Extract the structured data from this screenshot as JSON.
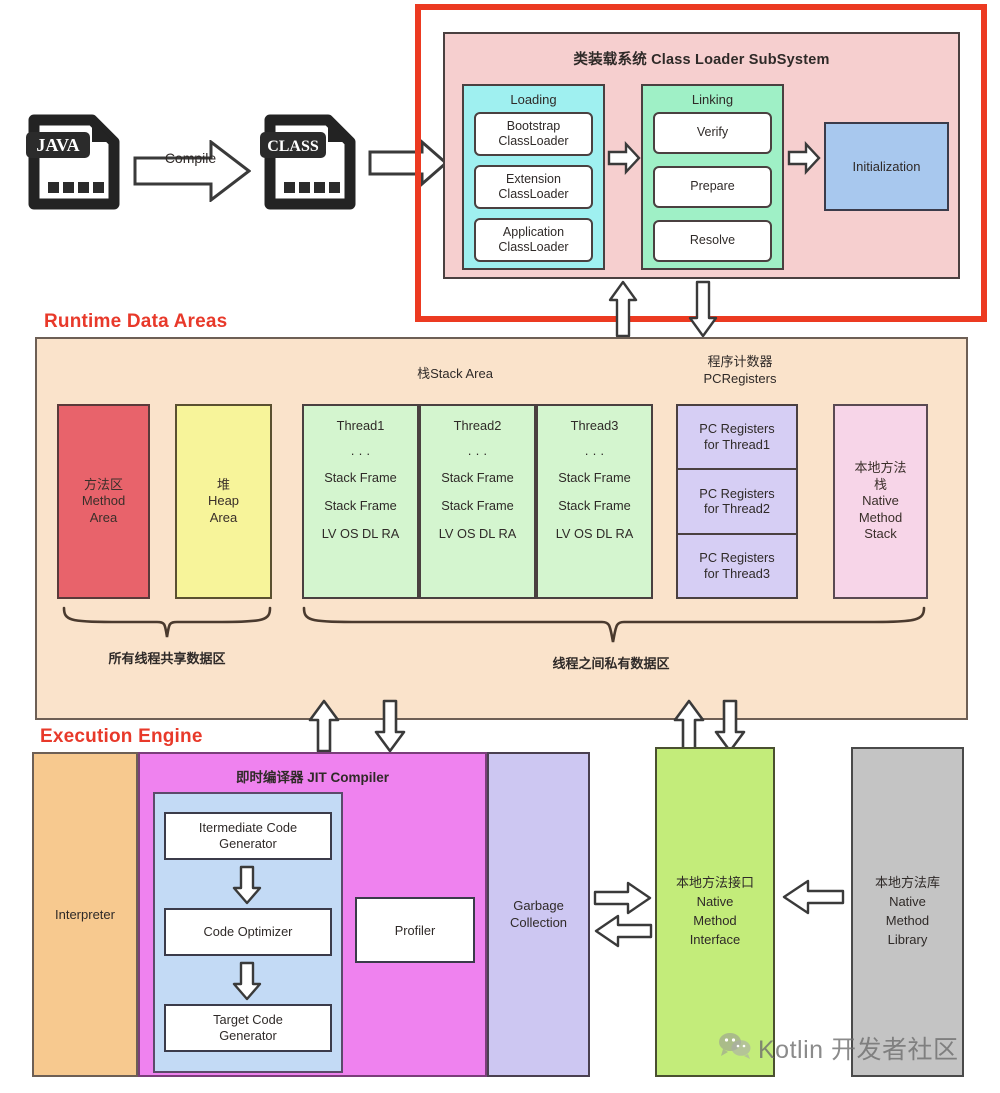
{
  "pipeline": {
    "java_file_label": "JAVA",
    "class_file_label": "CLASS",
    "compile_label": "Compile"
  },
  "class_loader": {
    "title": "类装载系统 Class Loader SubSystem",
    "loading": {
      "title": "Loading",
      "items": [
        "Bootstrap\nClassLoader",
        "Extension\nClassLoader",
        "Application\nClassLoader"
      ],
      "item_line1": [
        "Bootstrap",
        "Extension",
        "Application"
      ],
      "item_line2": [
        "ClassLoader",
        "ClassLoader",
        "ClassLoader"
      ]
    },
    "linking": {
      "title": "Linking",
      "items": [
        "Verify",
        "Prepare",
        "Resolve"
      ]
    },
    "initialization": "Initialization",
    "frame_color": "#ec3a21",
    "panel_color": "#f6cfcf",
    "loading_color": "#9ff0f0",
    "linking_color": "#9ff0c6",
    "initialization_color": "#a8c8ee"
  },
  "runtime_data_areas": {
    "section_title": "Runtime Data Areas",
    "panel_color": "#fae3cb",
    "stack_area_heading": "栈Stack Area",
    "pc_registers_heading_line1": "程序计数器",
    "pc_registers_heading_line2": "PCRegisters",
    "method_area": {
      "line1": "方法区",
      "line2": "Method",
      "line3": "Area",
      "color": "#e8636b"
    },
    "heap_area": {
      "line1": "堆",
      "line2": "Heap",
      "line3": "Area",
      "color": "#f7f49a"
    },
    "threads": [
      {
        "name": "Thread1",
        "dots": "· · ·",
        "frames": [
          "Stack Frame",
          "Stack Frame"
        ],
        "slots": "LV OS DL RA"
      },
      {
        "name": "Thread2",
        "dots": "· · ·",
        "frames": [
          "Stack Frame",
          "Stack Frame"
        ],
        "slots": "LV OS DL RA"
      },
      {
        "name": "Thread3",
        "dots": "· · ·",
        "frames": [
          "Stack Frame",
          "Stack Frame"
        ],
        "slots": "LV OS DL RA"
      }
    ],
    "thread_color": "#d4f5cf",
    "pc_registers": [
      "PC Registers\nfor Thread1",
      "PC Registers\nfor Thread2",
      "PC Registers\nfor Thread3"
    ],
    "pc_registers_lines": [
      [
        "PC Registers",
        "for Thread1"
      ],
      [
        "PC Registers",
        "for Thread2"
      ],
      [
        "PC Registers",
        "for Thread3"
      ]
    ],
    "pc_color": "#d6cef4",
    "native_method_stack": {
      "line1": "本地方法",
      "line2": "栈",
      "line3": "Native",
      "line4": "Method",
      "line5": "Stack",
      "color": "#f7d5e8"
    },
    "brace_shared_label": "所有线程共享数据区",
    "brace_private_label": "线程之间私有数据区"
  },
  "execution_engine": {
    "section_title": "Execution Engine",
    "interpreter": "Interpreter",
    "interpreter_color": "#f7c98f",
    "jit_title": "即时编译器 JIT Compiler",
    "jit_color": "#ef82ef",
    "jit_inner_color": "#c3daf5",
    "jit_steps": [
      {
        "line1": "Itermediate Code",
        "line2": "Generator"
      },
      {
        "line1": "Code Optimizer",
        "line2": ""
      },
      {
        "line1": "Target Code",
        "line2": "Generator"
      }
    ],
    "profiler": "Profiler",
    "garbage_collection": {
      "line1": "Garbage",
      "line2": "Collection",
      "color": "#cdc7f2"
    },
    "native_method_interface": {
      "line1": "本地方法接口",
      "line2": "Native",
      "line3": "Method",
      "line4": "Interface",
      "color": "#c3ec7a"
    },
    "native_method_library": {
      "line1": "本地方法库",
      "line2": "Native",
      "line3": "Method",
      "line4": "Library",
      "color": "#c4c4c4"
    }
  },
  "watermark": {
    "text": "Kotlin 开发者社区"
  }
}
